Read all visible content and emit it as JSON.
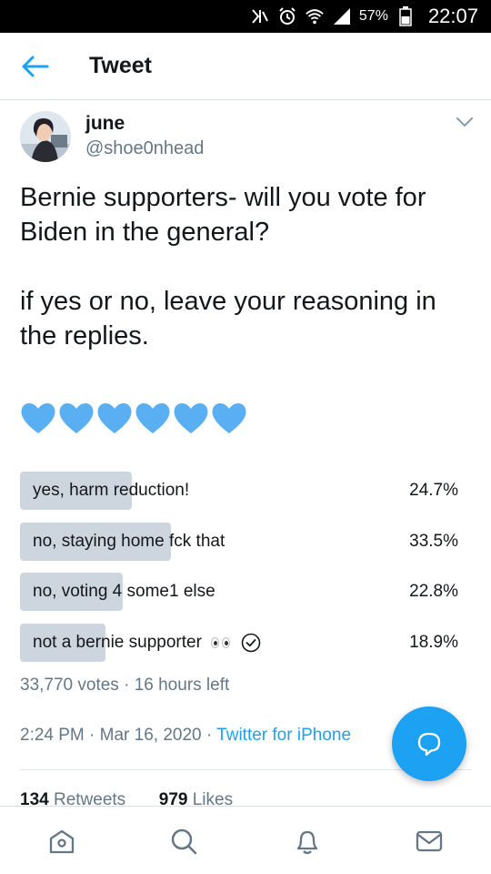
{
  "status_bar": {
    "battery_percent": "57%",
    "time": "22:07",
    "icons": [
      "nfc-icon",
      "alarm-icon",
      "wifi-icon",
      "signal-icon",
      "battery-icon"
    ]
  },
  "header": {
    "title": "Tweet",
    "back_icon": "back-arrow-icon"
  },
  "tweet": {
    "author_name": "june",
    "author_handle": "@shoe0nhead",
    "text": "Bernie supporters- will you vote for\nBiden in the general?\n\nif yes or no, leave your reasoning in\nthe replies.",
    "hearts_count": 6,
    "heart_color": "#5aaff2"
  },
  "poll": {
    "options": [
      {
        "label": "yes, harm reduction!",
        "percent": "24.7%",
        "fraction": 0.247
      },
      {
        "label": "no, staying home fck that",
        "percent": "33.5%",
        "fraction": 0.335
      },
      {
        "label": "no, voting 4 some1 else",
        "percent": "22.8%",
        "fraction": 0.228
      },
      {
        "label": "not a bernie supporter",
        "percent": "18.9%",
        "fraction": 0.189,
        "voted": true
      }
    ],
    "votes": "33,770 votes",
    "time_left": "16 hours left",
    "bar_color": "#cdd6de"
  },
  "meta": {
    "time": "2:24 PM",
    "date": "Mar 16, 2020",
    "source": "Twitter for iPhone"
  },
  "stats": {
    "retweets_count": "134",
    "retweets_label": "Retweets",
    "likes_count": "979",
    "likes_label": "Likes"
  },
  "accent_color": "#1da1f2",
  "nav": [
    "home-icon",
    "search-icon",
    "notifications-icon",
    "messages-icon"
  ]
}
